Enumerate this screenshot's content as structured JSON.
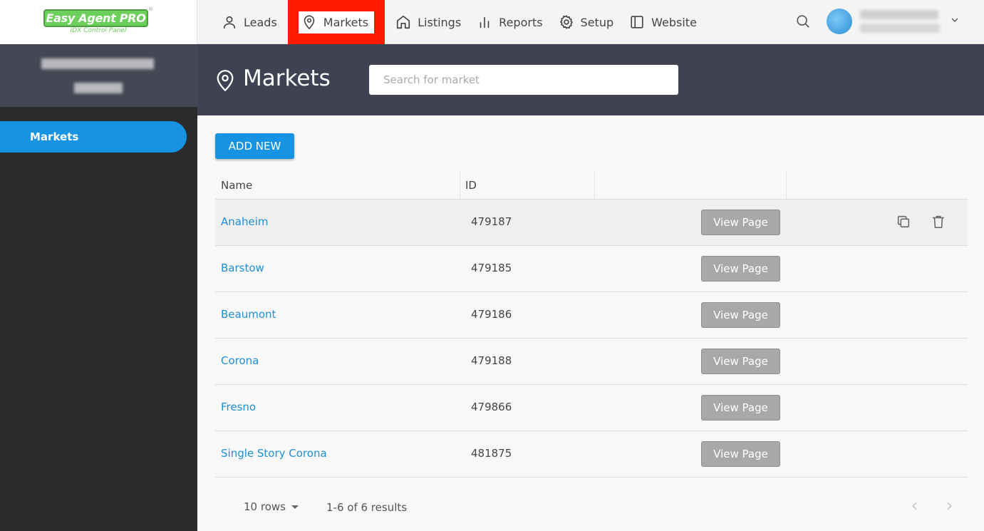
{
  "brand": {
    "logo_text": "Easy Agent PRO",
    "logo_sub": "IDX Control Panel",
    "logo_mark": "®"
  },
  "nav": {
    "leads": "Leads",
    "markets": "Markets",
    "listings": "Listings",
    "reports": "Reports",
    "setup": "Setup",
    "website": "Website",
    "active": "markets",
    "highlight_color": "#ff1a00"
  },
  "sidebar": {
    "items": [
      {
        "label": "Markets",
        "active": true
      }
    ],
    "accent": "#1793e3"
  },
  "header": {
    "title": "Markets",
    "search_placeholder": "Search for market",
    "bg": "#3e4252"
  },
  "toolbar": {
    "add_new_label": "ADD NEW"
  },
  "table": {
    "columns": [
      "Name",
      "ID"
    ],
    "view_label": "View Page",
    "rows": [
      {
        "name": "Anaheim",
        "id": "479187"
      },
      {
        "name": "Barstow",
        "id": "479185"
      },
      {
        "name": "Beaumont",
        "id": "479186"
      },
      {
        "name": "Corona",
        "id": "479188"
      },
      {
        "name": "Fresno",
        "id": "479866"
      },
      {
        "name": "Single Story Corona",
        "id": "481875"
      }
    ]
  },
  "pagination": {
    "rows_label": "10 rows",
    "results": "1-6 of 6 results"
  },
  "icons": [
    "person-icon",
    "map-pin-icon",
    "home-icon",
    "bar-chart-icon",
    "gear-icon",
    "sidebar-layout-icon",
    "search-icon",
    "chevron-down-icon",
    "copy-icon",
    "trash-icon",
    "chevron-left-icon",
    "chevron-right-icon"
  ]
}
